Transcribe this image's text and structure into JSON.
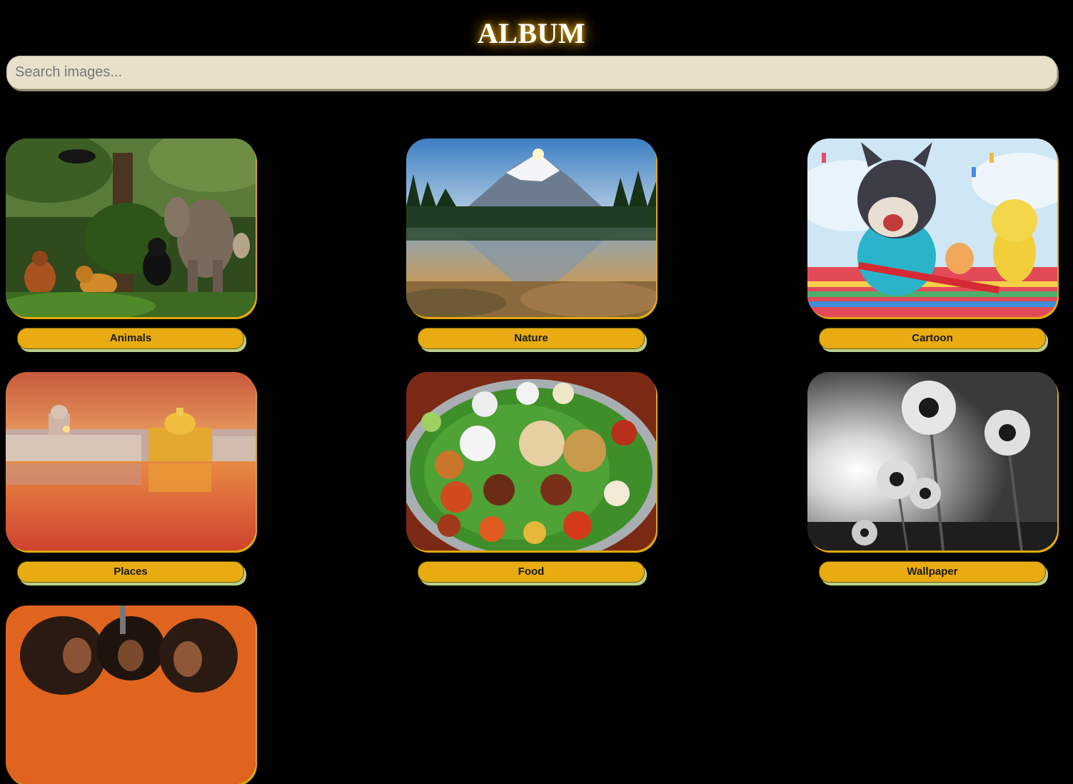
{
  "header": {
    "title": "ALBUM"
  },
  "search": {
    "placeholder": "Search images..."
  },
  "gallery": {
    "items": [
      {
        "label": "Animals",
        "image": "animals-jungle-image"
      },
      {
        "label": "Nature",
        "image": "mountain-lake-image"
      },
      {
        "label": "Cartoon",
        "image": "cartoon-race-image"
      },
      {
        "label": "Places",
        "image": "golden-temple-image"
      },
      {
        "label": "Food",
        "image": "thali-platter-image"
      },
      {
        "label": "Wallpaper",
        "image": "bw-flowers-image"
      },
      {
        "label": "",
        "image": "three-women-image"
      }
    ]
  },
  "colors": {
    "background": "#000000",
    "accent": "#e8ab12",
    "search_bg": "#e8e0cb",
    "title": "#ffffff",
    "glow": "#e0a10d"
  }
}
